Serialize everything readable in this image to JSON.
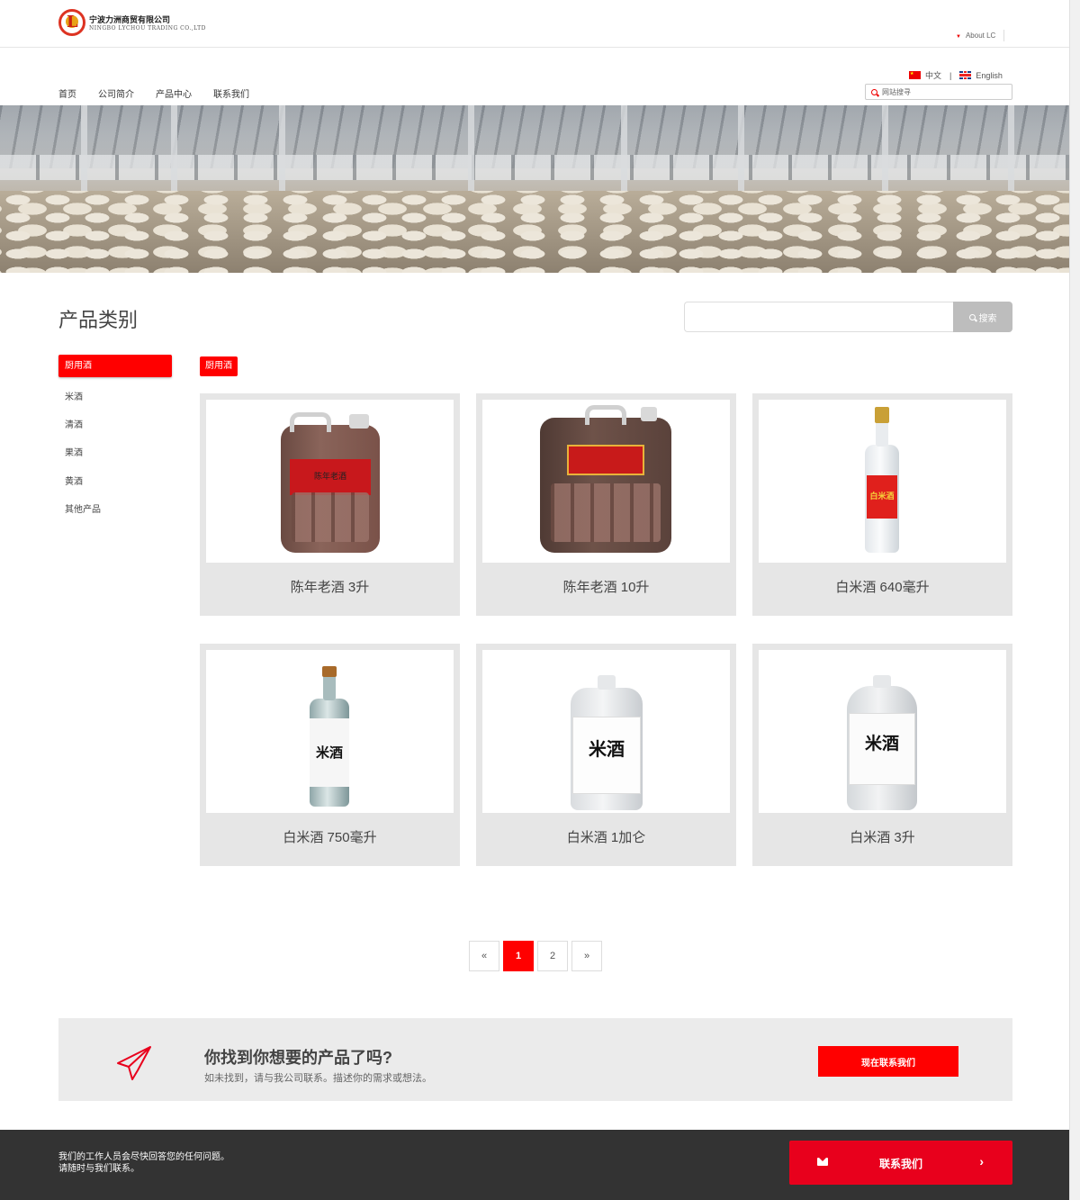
{
  "header": {
    "company_cn": "宁波力洲商贸有限公司",
    "company_en": "NINGBO LYCHOU TRADING CO.,LTD",
    "about_link": "About LC",
    "lang_cn": "中文",
    "lang_sep": "|",
    "lang_en": "English",
    "search_placeholder": "网站搜寻"
  },
  "nav": {
    "items": [
      "首页",
      "公司简介",
      "产品中心",
      "联系我们"
    ]
  },
  "category": {
    "title": "产品类别",
    "search_button": "搜索",
    "active": "厨用酒",
    "items": [
      "米酒",
      "清酒",
      "果酒",
      "黄酒",
      "其他产品"
    ],
    "tag": "厨用酒"
  },
  "products": [
    {
      "name": "陈年老酒 3升",
      "label": "陈年老酒"
    },
    {
      "name": "陈年老酒 10升",
      "label": ""
    },
    {
      "name": "白米酒 640毫升",
      "label": "白米酒"
    },
    {
      "name": "白米酒 750毫升",
      "label": "米酒"
    },
    {
      "name": "白米酒 1加仑",
      "label": "米酒"
    },
    {
      "name": "白米酒 3升",
      "label": "米酒"
    }
  ],
  "pagination": {
    "prev": "«",
    "pages": [
      "1",
      "2"
    ],
    "current": "1",
    "next": "»"
  },
  "cta": {
    "title": "你找到你想要的产品了吗?",
    "subtitle": "如未找到，请与我公司联系。描述你的需求或想法。",
    "button": "现在联系我们"
  },
  "footer": {
    "line1": "我们的工作人员会尽快回答您的任何问题。",
    "line2": "请随时与我们联系。",
    "button": "联系我们",
    "arrow": "›"
  },
  "colors": {
    "accent": "#ff0000",
    "footer_bg": "#333333",
    "card_bg": "#e6e6e6"
  }
}
